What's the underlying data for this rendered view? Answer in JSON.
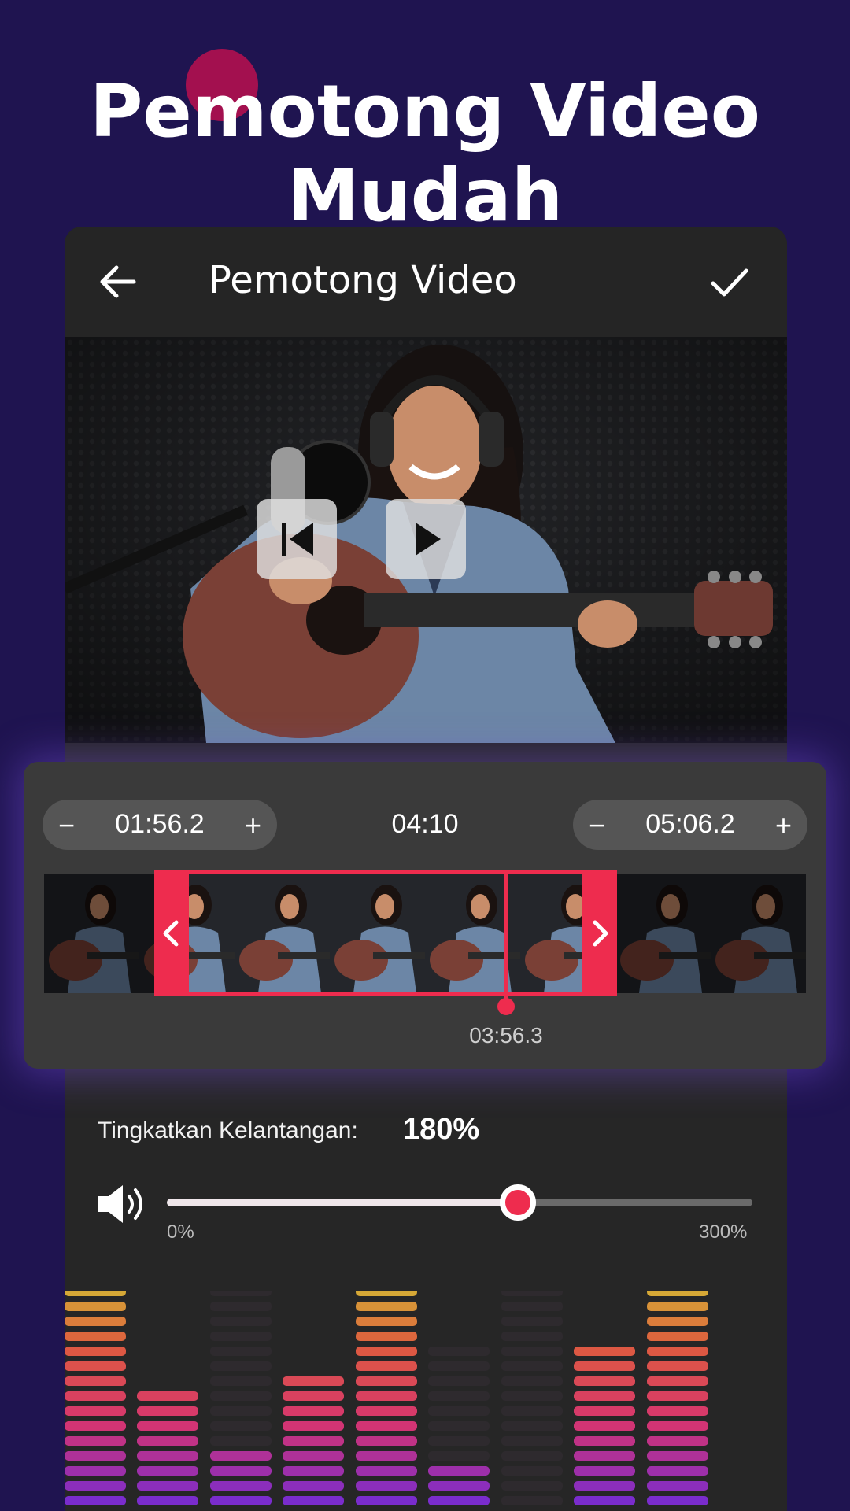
{
  "headline": "Pemotong Video Mudah",
  "app_bar": {
    "title": "Pemotong Video",
    "back_icon": "arrow-left-icon",
    "confirm_icon": "checkmark-icon"
  },
  "player": {
    "controls": [
      "skip-to-start-icon",
      "play-icon"
    ]
  },
  "trimmer": {
    "start": {
      "minus": "−",
      "value": "01:56.2",
      "plus": "+"
    },
    "duration": "04:10",
    "end": {
      "minus": "−",
      "value": "05:06.2",
      "plus": "+"
    },
    "playhead_time": "03:56.3",
    "colors": {
      "accent": "#ee2c4e"
    }
  },
  "volume": {
    "label": "Tingkatkan Kelantangan:",
    "value": "180%",
    "level": 0.6,
    "min_label": "0%",
    "max_label": "300%",
    "icon": "speaker-icon"
  },
  "colors": {
    "background": "#1f1450",
    "panel": "#262626",
    "accent": "#ee2c4e"
  }
}
